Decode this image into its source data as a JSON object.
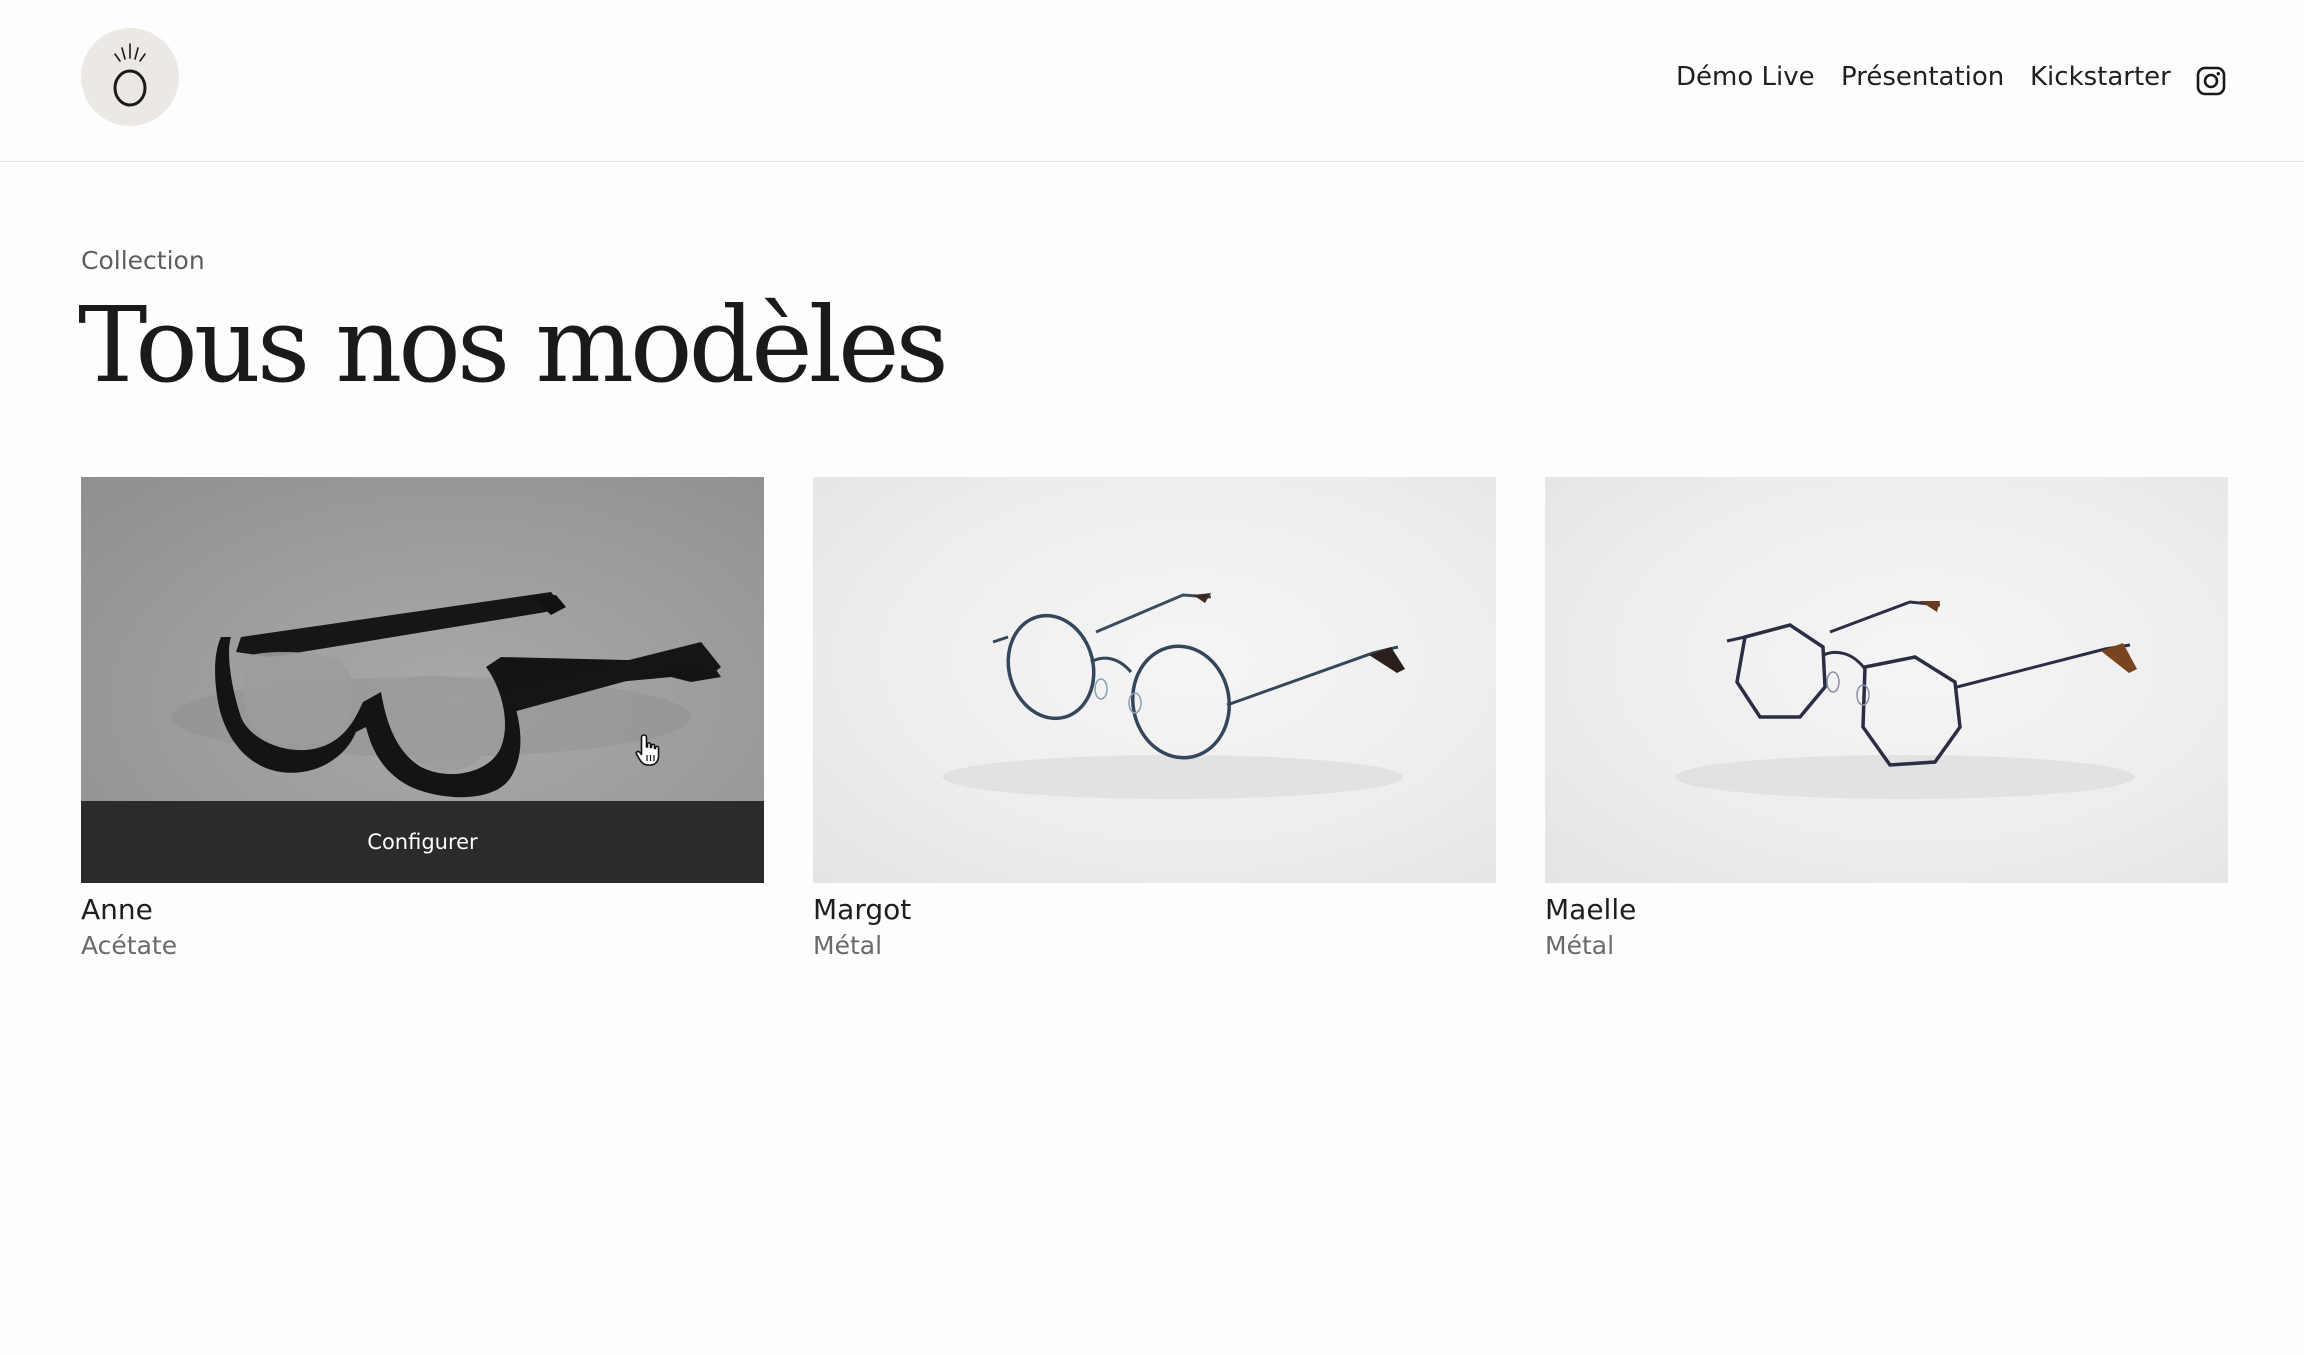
{
  "header": {
    "logo_letter": "O",
    "nav": {
      "demo": "Démo Live",
      "presentation": "Présentation",
      "kickstarter": "Kickstarter"
    },
    "instagram_icon": "instagram-icon"
  },
  "main": {
    "eyebrow": "Collection",
    "title": "Tous nos modèles"
  },
  "products": [
    {
      "name": "Anne",
      "material": "Acétate",
      "cta": "Configurer",
      "hovered": true
    },
    {
      "name": "Margot",
      "material": "Métal"
    },
    {
      "name": "Maelle",
      "material": "Métal"
    }
  ],
  "colors": {
    "cta_bg": "#2b2b2b",
    "logo_bg": "#ece9e4"
  }
}
